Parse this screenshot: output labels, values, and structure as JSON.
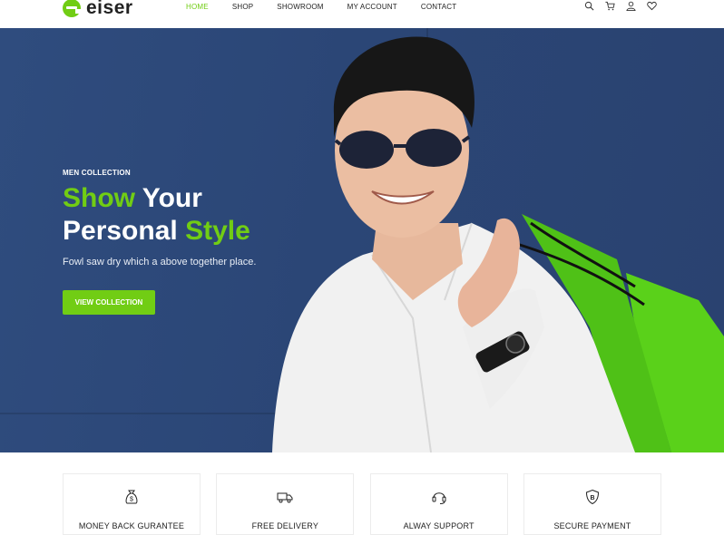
{
  "brand": {
    "name": "eiser",
    "accent_color": "#71cd14",
    "hero_bg_color": "#2b4676"
  },
  "nav": {
    "items": [
      {
        "label": "HOME",
        "active": true
      },
      {
        "label": "SHOP",
        "active": false
      },
      {
        "label": "SHOWROOM",
        "active": false
      },
      {
        "label": "MY ACCOUNT",
        "active": false
      },
      {
        "label": "CONTACT",
        "active": false
      }
    ]
  },
  "tools": {
    "icons": [
      "search-icon",
      "cart-icon",
      "user-icon",
      "heart-icon"
    ]
  },
  "hero": {
    "eyebrow": "MEN COLLECTION",
    "title_word1": "Show",
    "title_word2": "Your",
    "title_word3": "Personal",
    "title_word4": "Style",
    "subtitle": "Fowl saw dry which a above together place.",
    "button_label": "VIEW COLLECTION"
  },
  "features": [
    {
      "label": "MONEY BACK GURANTEE",
      "icon": "money-bag-icon"
    },
    {
      "label": "FREE DELIVERY",
      "icon": "truck-icon"
    },
    {
      "label": "ALWAY SUPPORT",
      "icon": "headset-icon"
    },
    {
      "label": "SECURE PAYMENT",
      "icon": "shield-icon"
    }
  ]
}
